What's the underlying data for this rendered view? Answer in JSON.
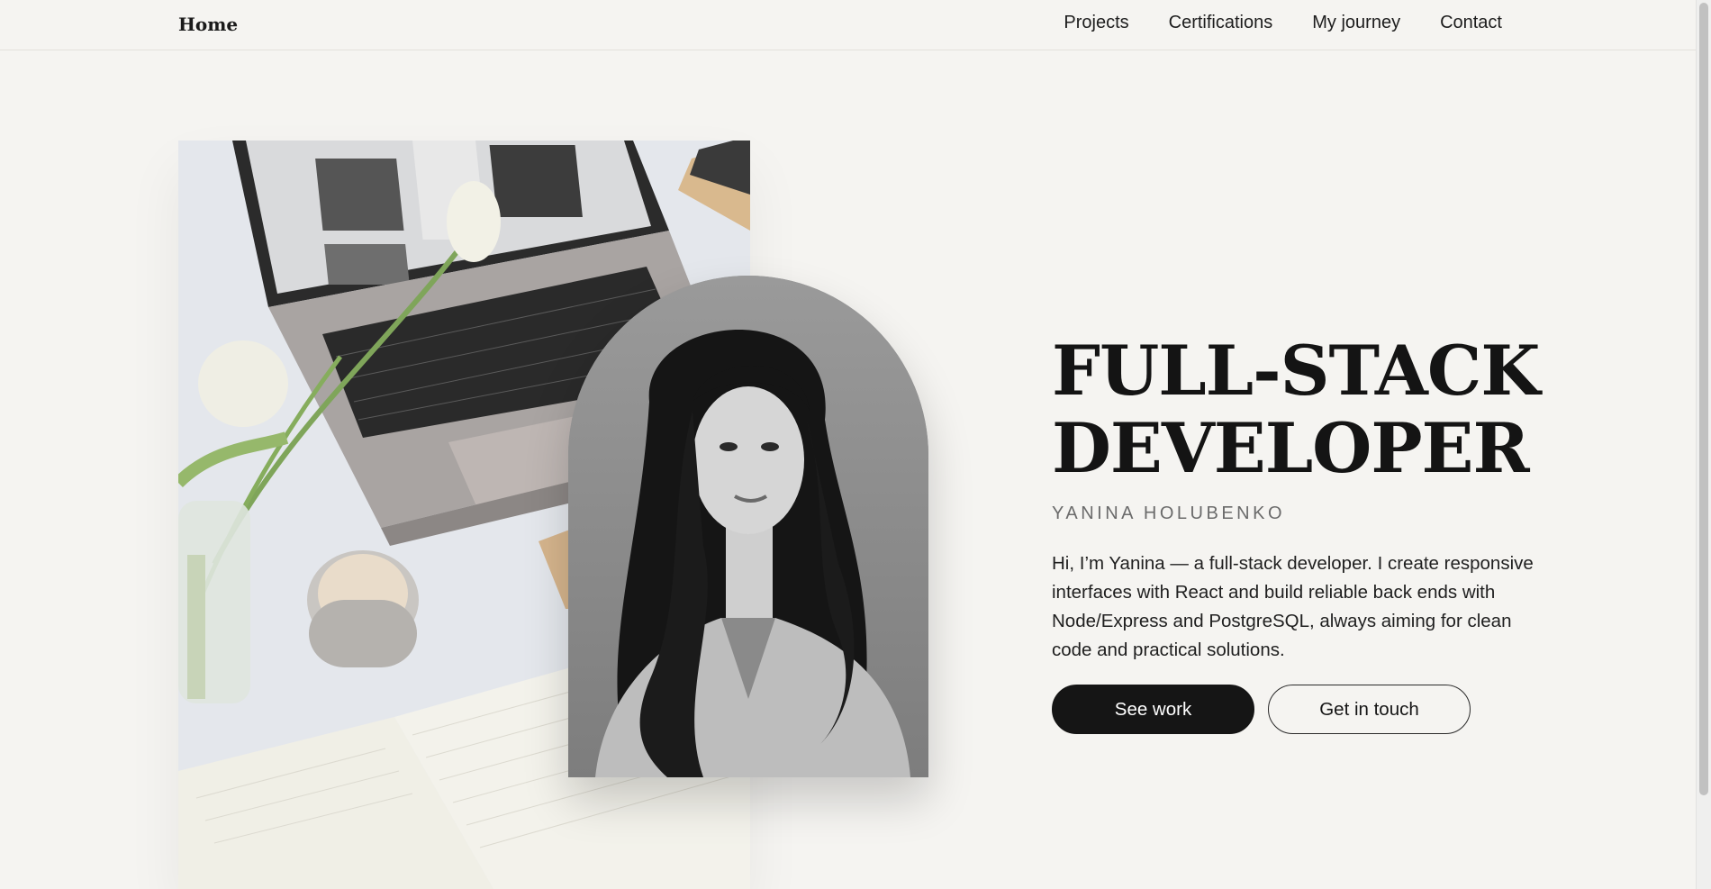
{
  "nav": {
    "brand": "Home",
    "links": [
      "Projects",
      "Certifications",
      "My journey",
      "Contact"
    ]
  },
  "hero": {
    "title_line1": "FULL-STACK",
    "title_line2": "DEVELOPER",
    "subtitle": "YANINA HOLUBENKO",
    "intro": "Hi, I’m Yanina — a full-stack developer. I create responsive interfaces with React and build reliable back ends with Node/Express and PostgreSQL, always aiming for clean code and practical solutions.",
    "primary_button": "See work",
    "secondary_button": "Get in touch"
  },
  "colors": {
    "background": "#f5f4f1",
    "text": "#151515",
    "button_dark": "#151515",
    "muted": "#6b6b6b"
  }
}
